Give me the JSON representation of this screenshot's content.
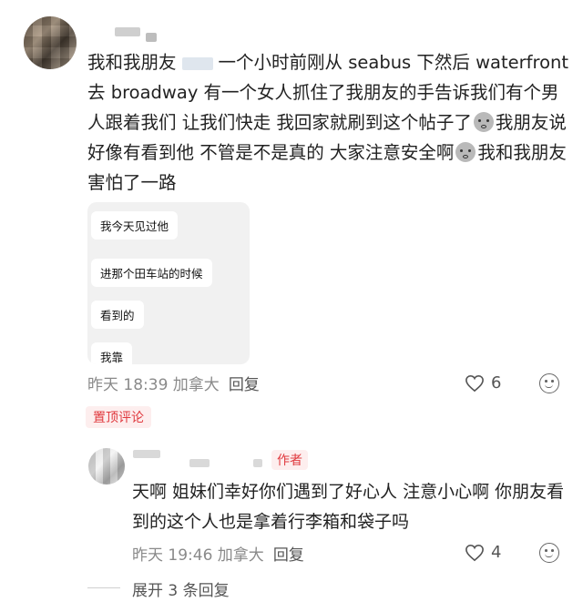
{
  "comment": {
    "text_part1": "我和我朋友",
    "text_part2": "一个小时前刚从 seabus 下然后 waterfront 去 broadway 有一个女人抓住了我朋友的手告诉我们有个男人跟着我们 让我们快走 我回家就刷到这个帖子了",
    "text_part3": "我朋友说好像有看到他 不管是不是真的 大家注意安全啊",
    "text_part4": "我和我朋友害怕了一路",
    "chat_messages": [
      "我今天见过他",
      "进那个田车站的时候",
      "看到的",
      "我靠"
    ],
    "time": "昨天 18:39 加拿大",
    "reply_label": "回复",
    "like_count": "6",
    "pinned_label": "置顶评论"
  },
  "reply": {
    "author_badge": "作者",
    "text": "天啊 姐妹们幸好你们遇到了好心人 注意小心啊 你朋友看到的这个人也是拿着行李箱和袋子吗",
    "time": "昨天 19:46 加拿大",
    "reply_label": "回复",
    "like_count": "4"
  },
  "expand_replies": "展开 3 条回复",
  "colors": {
    "accent_red": "#e0393e",
    "pinned_bg": "#fdeeee",
    "meta_gray": "#8a8a8a"
  },
  "icons": [
    "heart-icon",
    "emoji-face-icon",
    "sad-emoji-icon"
  ]
}
